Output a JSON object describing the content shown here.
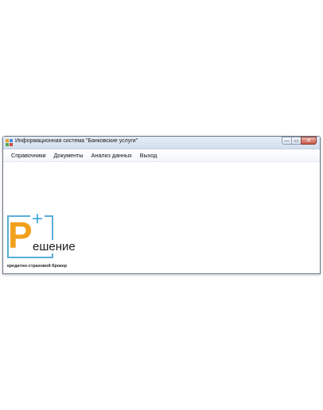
{
  "window": {
    "title": "Информационная система \"Банковские услуги\"",
    "buttons": {
      "minimize": "—",
      "maximize": "▭",
      "close": "✕"
    }
  },
  "menu": {
    "items": [
      {
        "label": "Справочники"
      },
      {
        "label": "Документы"
      },
      {
        "label": "Анализ данных"
      },
      {
        "label": "Выход"
      }
    ]
  },
  "logo": {
    "letter": "Р",
    "plus": "+",
    "word": "ешение",
    "tagline": "кредитно-страховой брокер"
  },
  "colors": {
    "logo_orange": "#f2a01c",
    "logo_blue": "#2f9ed8",
    "close_red": "#c8574a"
  }
}
